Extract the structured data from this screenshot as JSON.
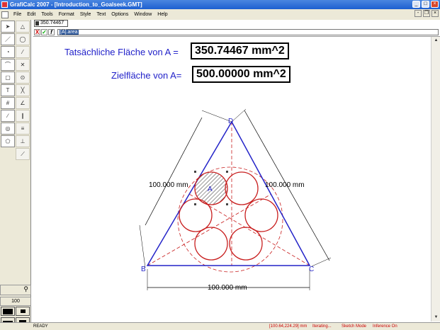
{
  "window": {
    "title": "GrafiCalc 2007 - [Introduction_to_Goalseek.GMT]",
    "min": "_",
    "max": "□",
    "close": "×"
  },
  "menu": [
    "File",
    "Edit",
    "Tools",
    "Format",
    "Style",
    "Text",
    "Options",
    "Window",
    "Help"
  ],
  "mdi": {
    "min": "-",
    "restore": "❐",
    "close": "×"
  },
  "toolbox": {
    "zoom": "100"
  },
  "value_box": "350.74467",
  "edit": {
    "cancel": "X",
    "accept": "✓",
    "fx": "f",
    "formula": "[A].area"
  },
  "fields": {
    "actual_label": "Tatsächliche Fläche von A =",
    "actual_value": "350.74467 mm^2",
    "target_label": "Zielfläche von A=",
    "target_value": "500.00000 mm^2"
  },
  "drawing": {
    "vertices": {
      "d": "D",
      "b": "B",
      "c": "C"
    },
    "circle_label": "A",
    "dim_left": "100.000 mm",
    "dim_right": "100.000 mm",
    "dim_bottom": "100.000 mm"
  },
  "status": {
    "ready": "READY",
    "coords": "[100.64,224.29] mm",
    "iterating": "Iterating...",
    "mode": "Sketch Mode",
    "inference": "Inference On"
  },
  "colors": {
    "triangle": "#2323c8",
    "circles": "#c81e1e",
    "labels": "#1f1fc9",
    "dim": "#000000"
  }
}
